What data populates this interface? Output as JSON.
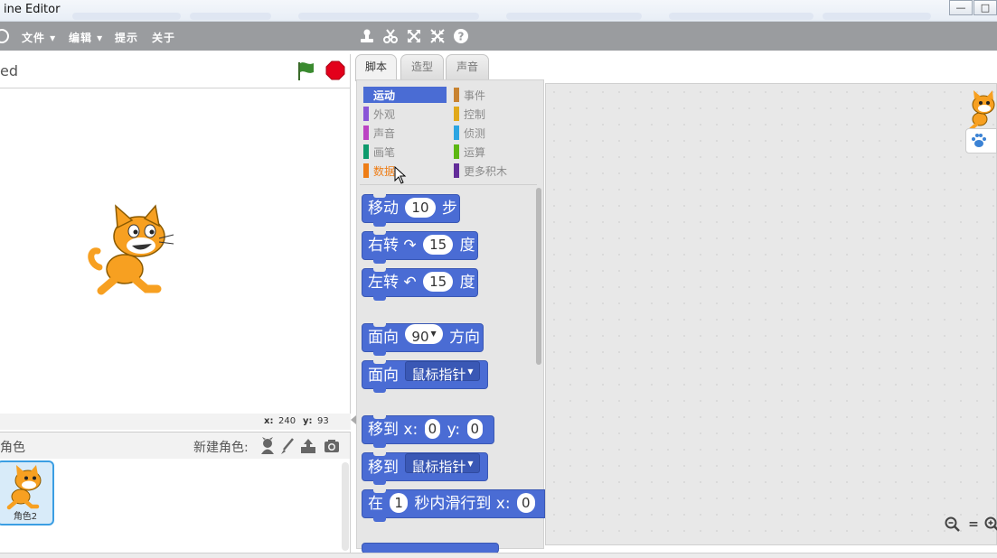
{
  "window": {
    "title": "ine Editor",
    "minimize_label": "—",
    "maximize_label": "□"
  },
  "menubar": {
    "items": [
      "文件 ▾",
      "编辑 ▾",
      "提示",
      "关于"
    ]
  },
  "stage": {
    "project_name": "ed",
    "coords": {
      "x_label": "x:",
      "x_value": "240",
      "y_label": "y:",
      "y_value": "93"
    }
  },
  "sprites": {
    "panel_label": "角色",
    "new_sprite_label": "新建角色:",
    "items": [
      {
        "name": "角色2"
      }
    ]
  },
  "tabs": [
    "脚本",
    "造型",
    "声音"
  ],
  "categories": [
    {
      "label": "运动",
      "color": "#4a6cd4",
      "selected": true
    },
    {
      "label": "事件",
      "color": "#c88330"
    },
    {
      "label": "外观",
      "color": "#8a55d7"
    },
    {
      "label": "控制",
      "color": "#e1a91a"
    },
    {
      "label": "声音",
      "color": "#bb42c3"
    },
    {
      "label": "侦测",
      "color": "#2ca5e2"
    },
    {
      "label": "画笔",
      "color": "#0e9a6c"
    },
    {
      "label": "运算",
      "color": "#5cb712"
    },
    {
      "label": "数据",
      "color": "#ee7d16"
    },
    {
      "label": "更多积木",
      "color": "#632d99"
    }
  ],
  "blocks": [
    {
      "parts": [
        "移动",
        "10",
        "步"
      ]
    },
    {
      "parts": [
        "右转",
        "↷",
        "15",
        "度"
      ]
    },
    {
      "parts": [
        "左转",
        "↶",
        "15",
        "度"
      ]
    },
    {
      "parts": [
        "面向",
        "90",
        "方向"
      ]
    },
    {
      "parts": [
        "面向",
        "鼠标指针"
      ]
    },
    {
      "parts": [
        "移到 x:",
        "0",
        "y:",
        "0"
      ]
    },
    {
      "parts": [
        "移到",
        "鼠标指针"
      ]
    },
    {
      "parts": [
        "在",
        "1",
        "秒内滑行到 x:",
        "0"
      ]
    }
  ],
  "zoom": {
    "out": "−",
    "reset": "=",
    "in": "+"
  },
  "colors": {
    "motion": "#4a6cd4",
    "menubar": "#9a9c9f",
    "stop": "#e3001b",
    "flag": "#3a8a2f"
  }
}
